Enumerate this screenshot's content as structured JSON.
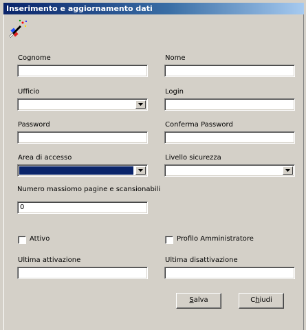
{
  "window": {
    "title": "Inserimento e aggiornamento dati"
  },
  "form": {
    "cognome": {
      "label": "Cognome",
      "value": ""
    },
    "nome": {
      "label": "Nome",
      "value": ""
    },
    "ufficio": {
      "label": "Ufficio",
      "value": ""
    },
    "login": {
      "label": "Login",
      "value": ""
    },
    "password": {
      "label": "Password",
      "value": ""
    },
    "conferma_password": {
      "label": "Conferma Password",
      "value": ""
    },
    "area_accesso": {
      "label": "Area di accesso",
      "value": ""
    },
    "livello_sicurezza": {
      "label": "Livello sicurezza",
      "value": ""
    },
    "max_pagine": {
      "label": "Numero massiomo pagine e scansionabili",
      "value": "0"
    },
    "attivo": {
      "label": "Attivo",
      "checked": false
    },
    "profilo_amministratore": {
      "label": "Profilo Amministratore",
      "checked": false
    },
    "ultima_attivazione": {
      "label": "Ultima attivazione",
      "value": ""
    },
    "ultima_disattivazione": {
      "label": "Ultima disattivazione",
      "value": ""
    }
  },
  "buttons": {
    "salva": {
      "accel": "S",
      "rest": "alva"
    },
    "chiudi": {
      "pre": "C",
      "accel": "h",
      "rest": "iudi"
    }
  },
  "colors": {
    "title_gradient_start": "#0a246a",
    "title_gradient_end": "#a6caf0",
    "window_bg": "#d4d0c8",
    "focus_highlight": "#0a246a"
  },
  "icons": {
    "app": "magic-wand-icon",
    "dropdown": "chevron-down-icon"
  }
}
